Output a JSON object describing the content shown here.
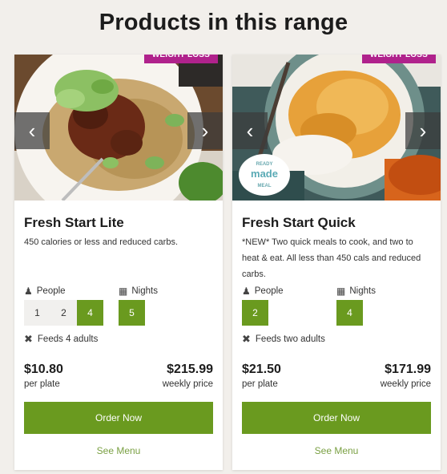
{
  "page": {
    "title": "Products in this range"
  },
  "colors": {
    "accent_green": "#6a9a1f",
    "badge_magenta": "#b0228c",
    "link_green": "#7aa043"
  },
  "products": [
    {
      "badge": "WEIGHT LOSS",
      "title": "Fresh Start Lite",
      "description": "450 calories or less and reduced carbs.",
      "people_label": "People",
      "people_options": [
        "1",
        "2",
        "4"
      ],
      "people_selected": "4",
      "nights_label": "Nights",
      "nights_options": [
        "5"
      ],
      "nights_selected": "5",
      "feeds_text": "Feeds 4 adults",
      "price_per_plate": "$10.80",
      "per_plate_label": "per plate",
      "weekly_price": "$215.99",
      "weekly_label": "weekly price",
      "order_label": "Order Now",
      "menu_label": "See Menu",
      "image_desc_icons": [
        "chevron-left-icon",
        "chevron-right-icon"
      ]
    },
    {
      "badge": "WEIGHT LOSS",
      "title": "Fresh Start Quick",
      "description": "*NEW* Two quick meals to cook, and two to heat & eat. All less than 450 cals and reduced carbs.",
      "logo_text": [
        "READY",
        "made",
        "MEAL"
      ],
      "people_label": "People",
      "people_options": [
        "2"
      ],
      "people_selected": "2",
      "nights_label": "Nights",
      "nights_options": [
        "4"
      ],
      "nights_selected": "4",
      "feeds_text": "Feeds two adults",
      "price_per_plate": "$21.50",
      "per_plate_label": "per plate",
      "weekly_price": "$171.99",
      "weekly_label": "weekly price",
      "order_label": "Order Now",
      "menu_label": "See Menu"
    }
  ],
  "icons": {
    "prev": "‹",
    "next": "›",
    "person": "person-icon",
    "calendar": "calendar-icon",
    "utensils": "utensils-icon"
  }
}
